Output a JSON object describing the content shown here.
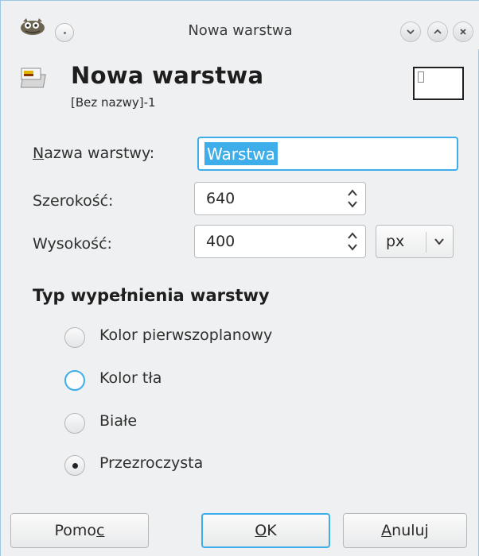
{
  "titlebar": {
    "title": "Nowa warstwa"
  },
  "header": {
    "title": "Nowa warstwa",
    "subtitle": "[Bez nazwy]-1"
  },
  "form": {
    "name_label_first": "N",
    "name_label_rest": "azwa warstwy:",
    "name_value": "Warstwa",
    "width_label": "Szerokość:",
    "width_value": "640",
    "height_label": "Wysokość:",
    "height_value": "400",
    "unit": "px"
  },
  "fill": {
    "section_title": "Typ wypełnienia warstwy",
    "options": [
      {
        "label": "Kolor pierwszoplanowy",
        "checked": false
      },
      {
        "label": "Kolor tła",
        "checked": false
      },
      {
        "label": "Białe",
        "checked": false
      },
      {
        "label": "Przezroczysta",
        "checked": true
      }
    ]
  },
  "buttons": {
    "help_pre": "Pomo",
    "help_u": "c",
    "ok_u": "O",
    "ok_rest": "K",
    "cancel_u": "A",
    "cancel_rest": "nuluj"
  },
  "colors": {
    "accent": "#3daee9",
    "background": "#eff0f1"
  }
}
